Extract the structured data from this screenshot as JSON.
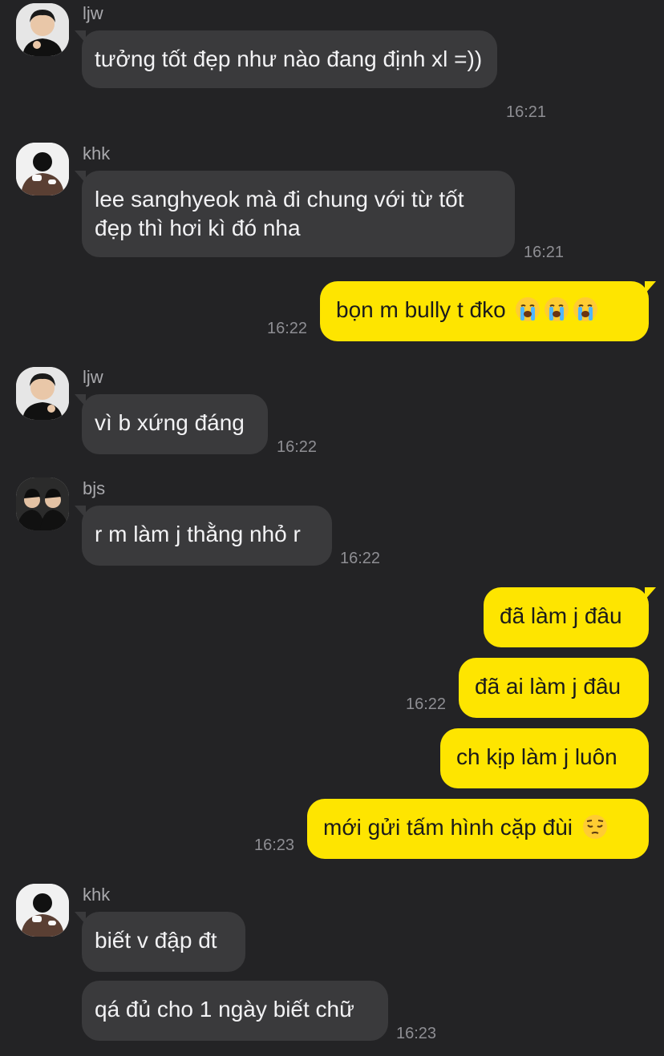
{
  "messages": {
    "m1": {
      "sender": "ljw",
      "text": "tưởng tốt đẹp như nào đang định xl =))",
      "time": "16:21"
    },
    "m2": {
      "sender": "khk",
      "text": "lee sanghyeok mà đi chung với từ tốt đẹp thì hơi kì đó nha",
      "time": "16:21"
    },
    "m3": {
      "text": "bọn m bully t đko",
      "emojis": [
        "loudly-crying-face",
        "loudly-crying-face",
        "loudly-crying-face"
      ],
      "time": "16:22"
    },
    "m4": {
      "sender": "ljw",
      "text": "vì b xứng đáng",
      "time": "16:22"
    },
    "m5": {
      "sender": "bjs",
      "text": "r m làm j thằng nhỏ r",
      "time": "16:22"
    },
    "m6": {
      "text": "đã làm j đâu"
    },
    "m7": {
      "text": "đã ai làm j đâu",
      "time": "16:22"
    },
    "m8": {
      "text": "ch kịp làm j luôn"
    },
    "m9": {
      "text": "mới gửi tấm hình cặp đùi",
      "emojis": [
        "pensive-face"
      ],
      "time": "16:23"
    },
    "m10": {
      "sender": "khk",
      "text": "biết v đập đt"
    },
    "m11": {
      "text": "qá đủ cho 1 ngày biết chữ",
      "time": "16:23"
    }
  },
  "colors": {
    "background": "#232325",
    "incoming_bubble": "#3a3a3c",
    "outgoing_bubble": "#fee500",
    "timestamp": "#8e8e93"
  }
}
